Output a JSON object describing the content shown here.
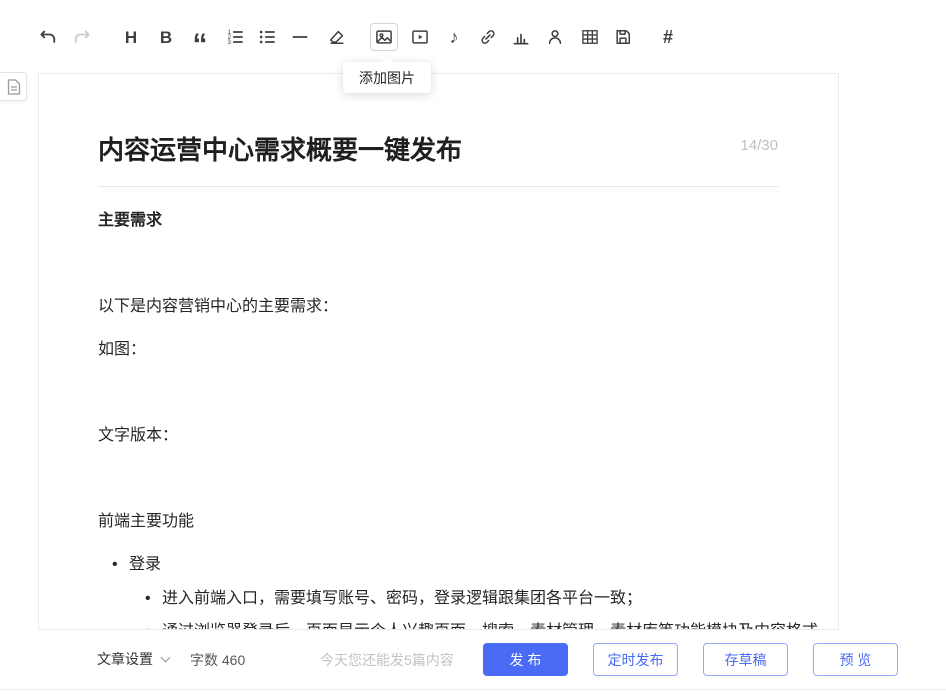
{
  "colors": {
    "accent": "#4a6bf5"
  },
  "toolbar": {
    "tooltip": "添加图片",
    "glyphs": {
      "heading": "H",
      "bold": "B",
      "quote": "“",
      "audio": "♪",
      "topic": "#"
    }
  },
  "document": {
    "title": "内容运营中心需求概要一键发布",
    "counter": "14/30",
    "paragraphs": [
      "主要需求",
      "以下是内容营销中心的主要需求：",
      "如图：",
      "文字版本：",
      "前端主要功能"
    ],
    "list": [
      "登录",
      "进入前端入口，需要填写账号、密码，登录逻辑跟集团各平台一致；",
      "通过浏览器登录后，页面显示个人兴趣页面，搜索、素材管理、素材库等功能模块及内容格式"
    ]
  },
  "footer": {
    "article_settings": "文章设置",
    "word_count": "字数 460",
    "quota": "今天您还能发5篇内容",
    "buttons": {
      "publish": "发 布",
      "schedule": "定时发布",
      "draft": "存草稿",
      "preview": "预 览"
    }
  }
}
